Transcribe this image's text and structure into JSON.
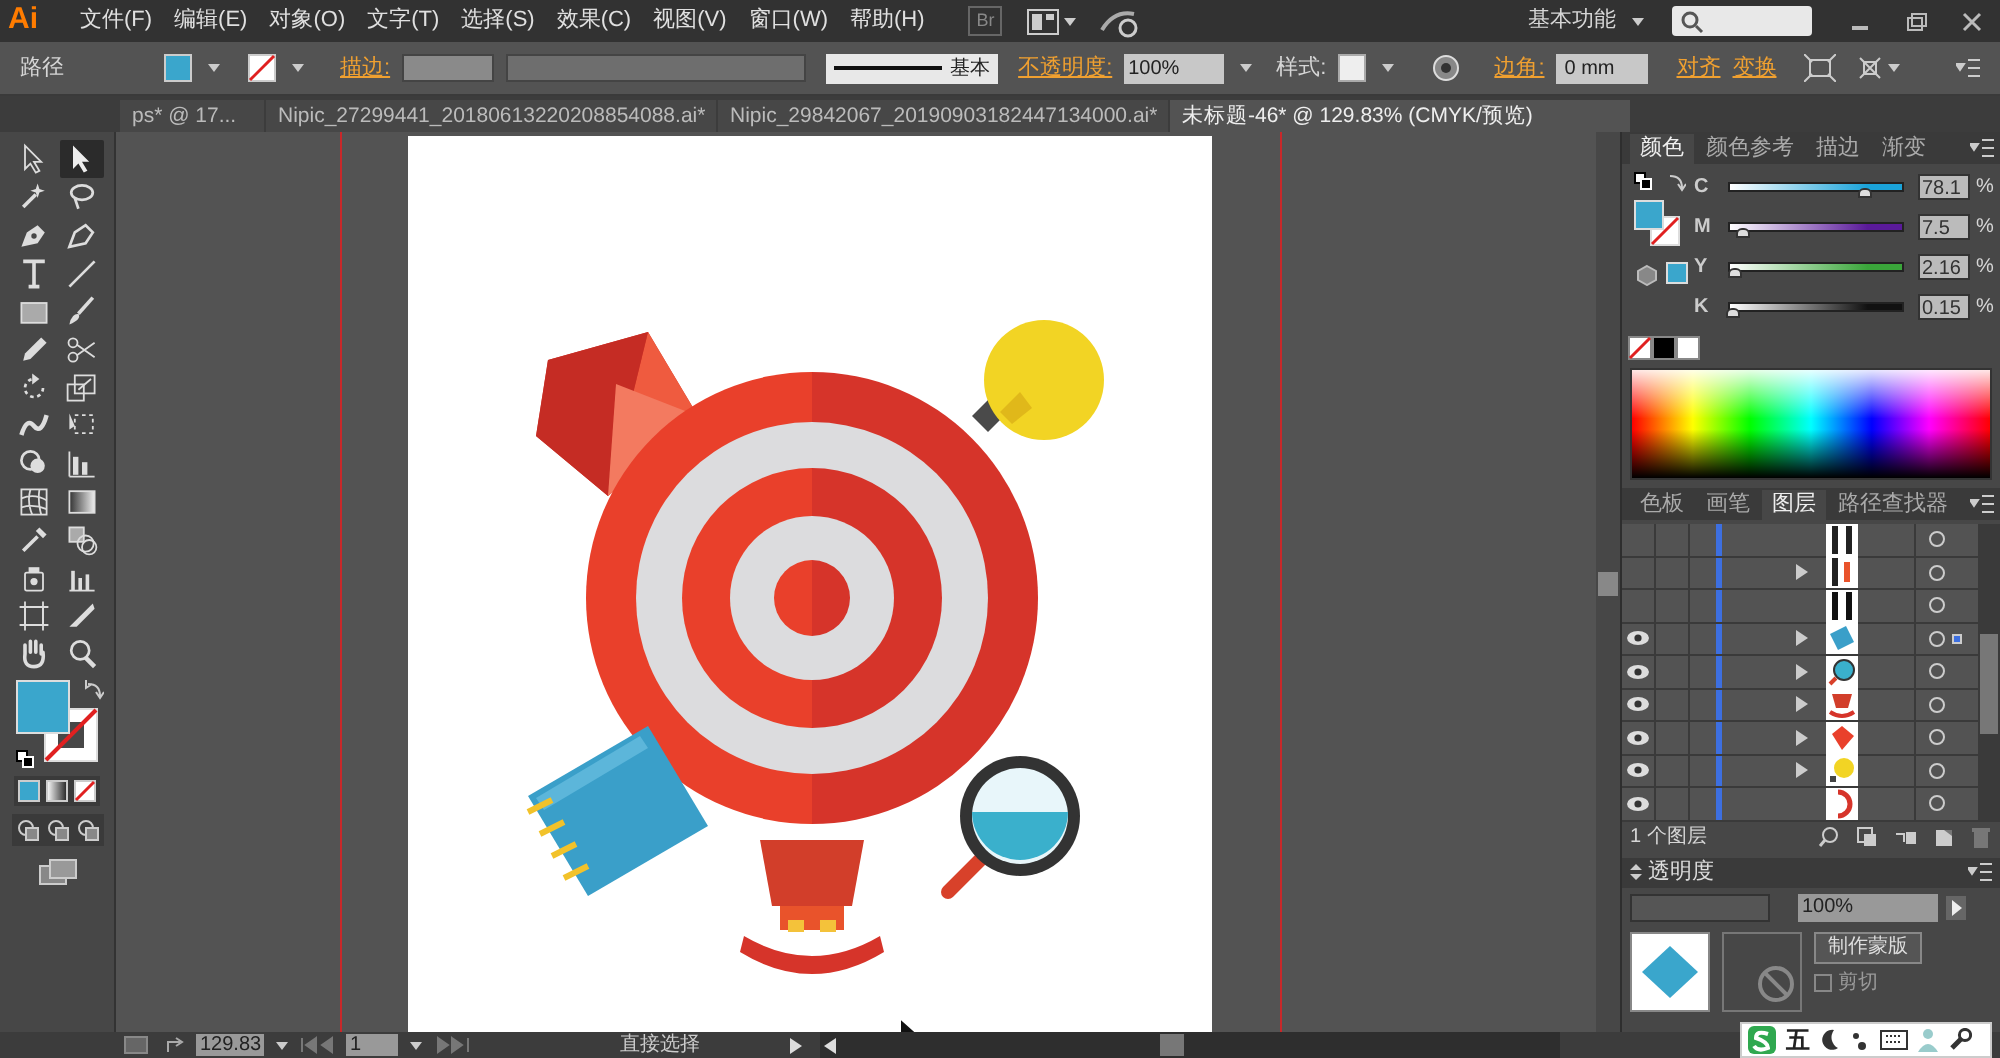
{
  "menu_bar": {
    "logo": "Ai",
    "items": [
      "文件(F)",
      "编辑(E)",
      "对象(O)",
      "文字(T)",
      "选择(S)",
      "效果(C)",
      "视图(V)",
      "窗口(W)",
      "帮助(H)"
    ],
    "bridge": "Br",
    "workspace": "基本功能"
  },
  "control_bar": {
    "object_type": "路径",
    "fill": {
      "color": "#3aa6cc"
    },
    "stroke_label": "描边:",
    "stroke_style": "基本",
    "opacity_label": "不透明度:",
    "opacity": "100%",
    "style_label": "样式:",
    "corner_label": "边角:",
    "corner": "0 mm",
    "align": "对齐",
    "transform": "变换"
  },
  "document_tabs": [
    {
      "label": "ps* @ 17...",
      "selected": false
    },
    {
      "label": "Nipic_27299441_20180613220208854088.ai*",
      "selected": false
    },
    {
      "label": "Nipic_29842067_20190903182447134000.ai*",
      "selected": false
    },
    {
      "label": "未标题-46* @ 129.83% (CMYK/预览)",
      "selected": true
    }
  ],
  "toolbar": {
    "tools": [
      {
        "selected": false
      },
      {
        "selected": true
      },
      {
        "selected": false
      },
      {
        "selected": false
      },
      {
        "selected": false
      },
      {
        "selected": false
      },
      {
        "selected": false
      },
      {
        "selected": false
      },
      {
        "selected": false
      },
      {
        "selected": false
      },
      {
        "selected": false
      },
      {
        "selected": false
      },
      {
        "selected": false
      },
      {
        "selected": false
      },
      {
        "selected": false
      },
      {
        "selected": false
      },
      {
        "selected": false
      },
      {
        "selected": false
      },
      {
        "selected": false
      },
      {
        "selected": false
      },
      {
        "selected": false
      },
      {
        "selected": false
      },
      {
        "selected": false
      },
      {
        "selected": false
      },
      {
        "selected": false
      },
      {
        "selected": false
      },
      {
        "selected": false
      },
      {
        "selected": false
      }
    ],
    "fill": {
      "color": "#3aa6cc"
    }
  },
  "color_panel": {
    "tabs": [
      {
        "label": "颜色",
        "selected": true
      },
      {
        "label": "颜色参考",
        "selected": false
      },
      {
        "label": "描边",
        "selected": false
      },
      {
        "label": "渐变",
        "selected": false
      }
    ],
    "fill": {
      "color": "#3aa6cc"
    },
    "sliders": [
      {
        "channel": "C",
        "level": 0.78,
        "reading": "78.1",
        "unit": "%",
        "color": "#1aa3d9"
      },
      {
        "channel": "M",
        "level": 0.075,
        "reading": "7.5",
        "unit": "%",
        "color": "#5a1a9a"
      },
      {
        "channel": "Y",
        "level": 0.02,
        "reading": "2.16",
        "unit": "%",
        "color": "#3aa63a"
      },
      {
        "channel": "K",
        "level": 0.015,
        "reading": "0.15",
        "unit": "%",
        "color": "#111111"
      }
    ]
  },
  "layers_panel": {
    "tabs": [
      {
        "label": "色板",
        "selected": false
      },
      {
        "label": "画笔",
        "selected": false
      },
      {
        "label": "图层",
        "selected": true
      },
      {
        "label": "路径查找器",
        "selected": false
      }
    ],
    "rows": [
      {
        "visible": false,
        "expandable": false,
        "selected": false
      },
      {
        "visible": false,
        "expandable": true,
        "selected": false
      },
      {
        "visible": false,
        "expandable": false,
        "selected": false
      },
      {
        "visible": true,
        "expandable": true,
        "selected": true
      },
      {
        "visible": true,
        "expandable": true,
        "selected": false
      },
      {
        "visible": true,
        "expandable": true,
        "selected": false
      },
      {
        "visible": true,
        "expandable": true,
        "selected": false
      },
      {
        "visible": true,
        "expandable": true,
        "selected": false
      },
      {
        "visible": true,
        "expandable": false,
        "selected": false
      }
    ],
    "footer": "1 个图层"
  },
  "transparency_panel": {
    "title": "透明度",
    "opacity": "100%",
    "make_mask": "制作蒙版",
    "clip": "剪切",
    "clip_checked": false
  },
  "ime_bar": {
    "mode": "五"
  },
  "status_bar": {
    "zoom": "129.83",
    "artboard": "1",
    "tool": "直接选择"
  }
}
